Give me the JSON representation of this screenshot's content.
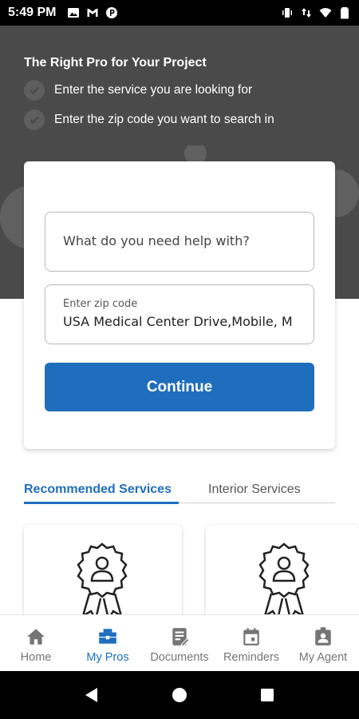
{
  "status_bar": {
    "time": "5:49 PM",
    "left_icons": [
      "image-icon",
      "gmail-icon",
      "p-app-icon"
    ],
    "right_icons": [
      "vibrate-icon",
      "data-arrows-icon",
      "wifi-icon",
      "battery-icon"
    ]
  },
  "hero": {
    "title": "The Right Pro for Your Project",
    "items": [
      "Enter the service you are looking for",
      "Enter the zip code you want to search in"
    ]
  },
  "form": {
    "service_placeholder": "What do you need help with?",
    "zip_label": "Enter zip code",
    "zip_value": "USA Medical Center Drive,Mobile, M",
    "continue_label": "Continue"
  },
  "tabs": [
    {
      "label": "Recommended Services",
      "active": true
    },
    {
      "label": "Interior Services",
      "active": false
    }
  ],
  "bottom_nav": [
    {
      "label": "Home",
      "icon": "home-icon",
      "active": false
    },
    {
      "label": "My Pros",
      "icon": "toolbox-icon",
      "active": true
    },
    {
      "label": "Documents",
      "icon": "document-icon",
      "active": false
    },
    {
      "label": "Reminders",
      "icon": "calendar-icon",
      "active": false
    },
    {
      "label": "My Agent",
      "icon": "agent-badge-icon",
      "active": false
    }
  ],
  "colors": {
    "accent": "#1f6ebd",
    "hero_bg": "#4a4a4a",
    "inactive": "#757575"
  }
}
